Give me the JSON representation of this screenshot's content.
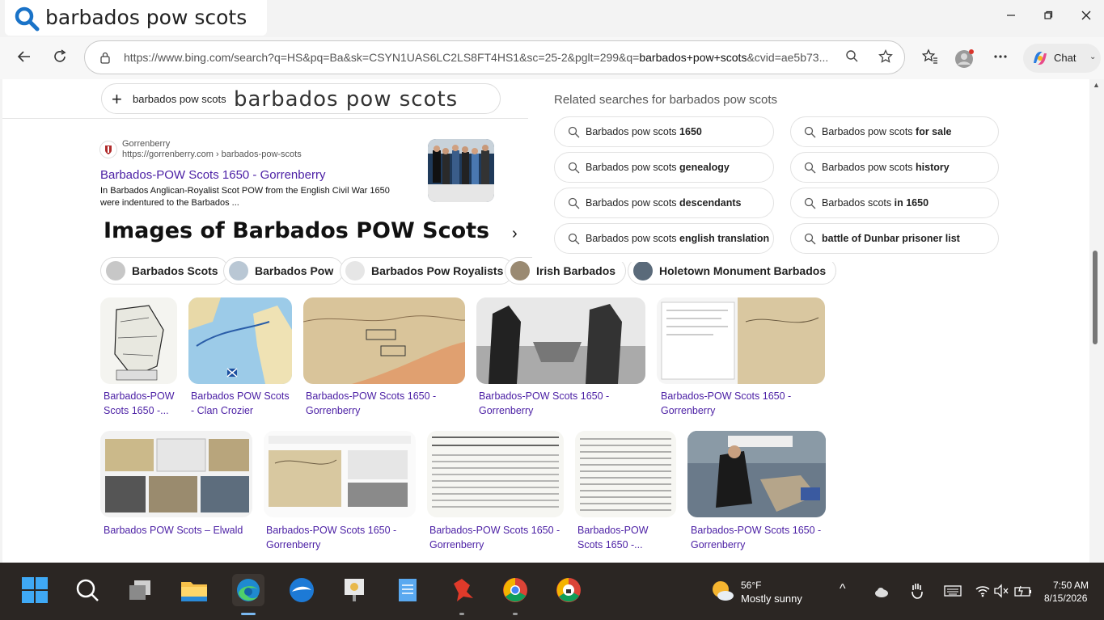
{
  "browser": {
    "tab_search_text": "barbados pow scots",
    "url_prefix": "https://www.bing.com/search?q=HS&pq=Ba&sk=CSYN1UAS6LC2LS8FT4HS1&sc=25-2&pglt=299&q=",
    "url_query": "barbados+pow+scots",
    "url_suffix": "&cvid=ae5b73...",
    "chat_label": "Chat"
  },
  "search": {
    "pill_small": "barbados pow scots",
    "pill_big": "barbados pow scots"
  },
  "result": {
    "site_name": "Gorrenberry",
    "site_url": "https://gorrenberry.com › barbados-pow-scots",
    "title": "Barbados-POW Scots 1650 - Gorrenberry",
    "snippet": "In Barbados Anglican-Royalist Scot POW from the English Civil War 1650 were indentured to the Barbados ..."
  },
  "images": {
    "heading": "Images of Barbados POW Scots",
    "chips": [
      "Barbados Scots",
      "Barbados Pow",
      "Barbados Pow Royalists",
      "Irish Barbados",
      "Holetown Monument Barbados"
    ],
    "row1": [
      {
        "caption": "Barbados-POW Scots 1650 -..."
      },
      {
        "caption": "Barbados POW Scots - Clan Crozier"
      },
      {
        "caption": "Barbados-POW Scots 1650 - Gorrenberry"
      },
      {
        "caption": "Barbados-POW Scots 1650 - Gorrenberry"
      },
      {
        "caption": "Barbados-POW Scots 1650 - Gorrenberry"
      }
    ],
    "row2": [
      {
        "caption": "Barbados POW Scots – Elwald"
      },
      {
        "caption": "Barbados-POW Scots 1650 - Gorrenberry"
      },
      {
        "caption": "Barbados-POW Scots 1650 - Gorrenberry"
      },
      {
        "caption": "Barbados-POW Scots 1650 -..."
      },
      {
        "caption": "Barbados-POW Scots 1650 - Gorrenberry"
      }
    ]
  },
  "related": {
    "title": "Related searches for barbados pow scots",
    "items": [
      {
        "prefix": "Barbados pow scots ",
        "bold": "1650"
      },
      {
        "prefix": "Barbados pow scots ",
        "bold": "for sale"
      },
      {
        "prefix": "Barbados pow scots ",
        "bold": "genealogy"
      },
      {
        "prefix": "Barbados pow scots ",
        "bold": "history"
      },
      {
        "prefix": "Barbados pow scots ",
        "bold": "descendants"
      },
      {
        "prefix": "Barbados scots ",
        "bold": "in 1650"
      },
      {
        "prefix": "Barbados pow scots ",
        "bold": "english translation"
      },
      {
        "prefix": "",
        "bold": "battle of Dunbar prisoner list"
      }
    ]
  },
  "taskbar": {
    "weather_temp": "56°F",
    "weather_desc": "Mostly sunny",
    "time": "7:50 AM",
    "date": "8/15/2026"
  }
}
